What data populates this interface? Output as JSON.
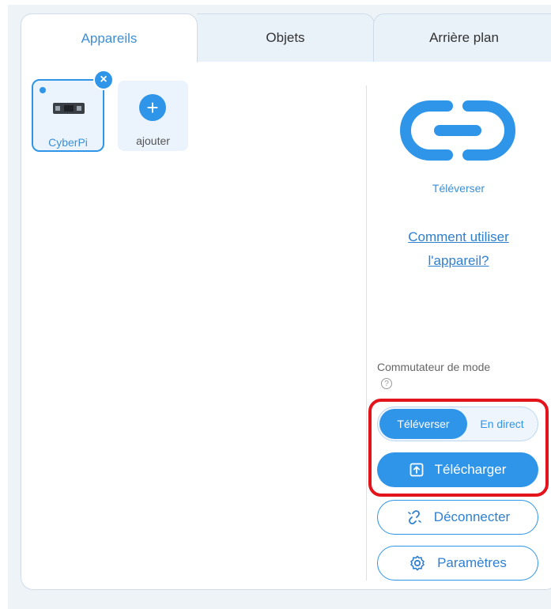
{
  "tabs": {
    "devices": "Appareils",
    "sprites": "Objets",
    "background": "Arrière plan"
  },
  "devices": {
    "items": [
      {
        "label": "CyberPi"
      }
    ],
    "close_symbol": "×",
    "add_symbol": "+",
    "add_label": "ajouter"
  },
  "right_panel": {
    "upload_caption": "Téléverser",
    "help_link_line1": "Comment utiliser",
    "help_link_line2": "l'appareil?",
    "mode_switch_label": "Commutateur de mode",
    "mode_help_symbol": "?",
    "mode_upload": "Téléverser",
    "mode_live": "En direct",
    "download_button": "Télécharger",
    "disconnect_button": "Déconnecter",
    "settings_button": "Paramètres"
  },
  "colors": {
    "accent": "#2f95e8",
    "highlight": "#e3141c",
    "icons": [
      "link-icon",
      "upload-icon",
      "disconnect-icon",
      "gear-icon",
      "close-icon",
      "plus-icon",
      "help-icon"
    ]
  }
}
